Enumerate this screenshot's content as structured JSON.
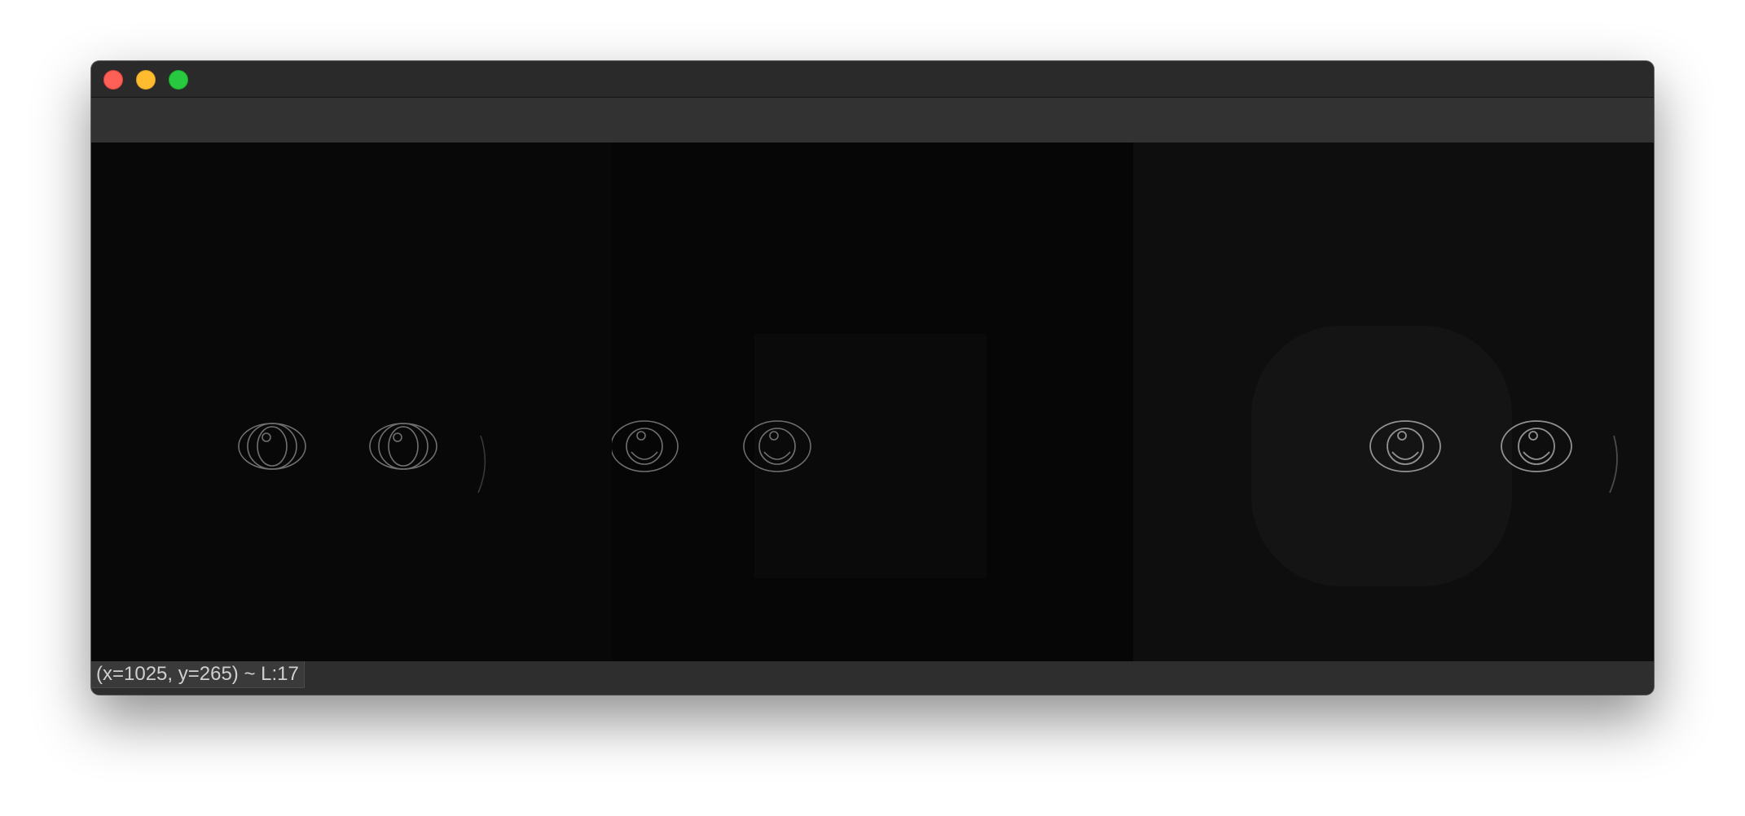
{
  "window": {
    "controls": [
      "close",
      "minimize",
      "maximize"
    ],
    "colors": {
      "close": "#fe5f57",
      "minimize": "#febc2e",
      "maximize": "#28c840"
    }
  },
  "image": {
    "description_panels": 3
  },
  "status": {
    "text": "(x=1025, y=265) ~ L:17"
  }
}
